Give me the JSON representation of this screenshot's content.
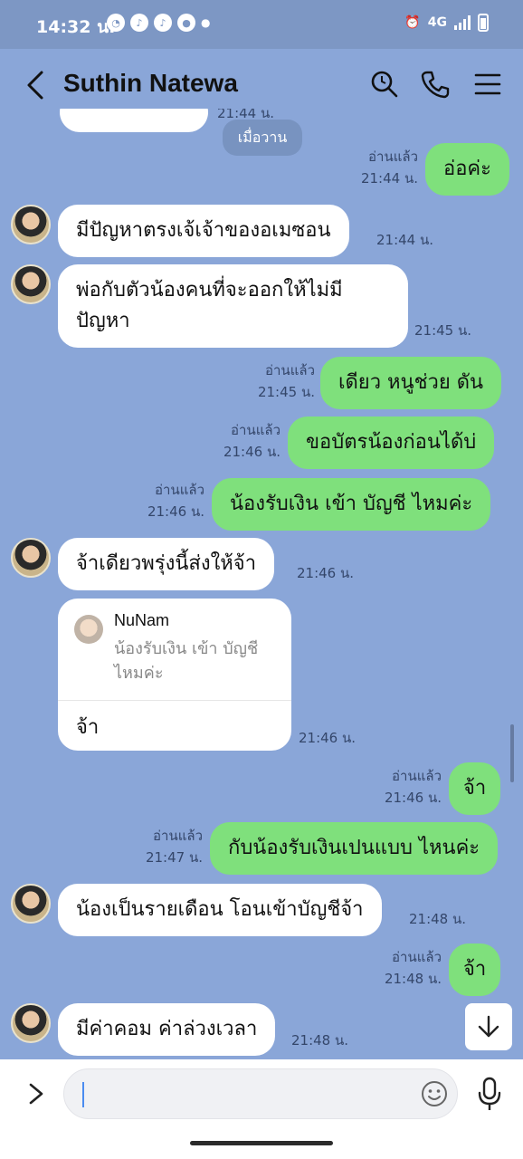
{
  "status_bar": {
    "time": "14:32 น.",
    "network": "4G"
  },
  "header": {
    "title": "Suthin Natewa"
  },
  "date_separator": "เมื่อวาน",
  "messages": [
    {
      "dir": "out",
      "text": "อ่อค่ะ",
      "read": "อ่านแล้ว",
      "time": "21:44 น."
    },
    {
      "dir": "in",
      "text": "มีปัญหาตรงเจ้เจ้าของอเมซอน",
      "time": "21:44 น."
    },
    {
      "dir": "in",
      "text": "พ่อกับตัวน้องคนที่จะออกให้ไม่มี\nปัญหา",
      "line1": "พ่อกับตัวน้องคนที่จะออกให้ไม่มี",
      "line2": "ปัญหา",
      "time": "21:45 น."
    },
    {
      "dir": "out",
      "text": "เดียว หนูช่วย ดัน",
      "read": "อ่านแล้ว",
      "time": "21:45 น."
    },
    {
      "dir": "out",
      "text": "ขอบัตรน้องก่อนได้บ่",
      "read": "อ่านแล้ว",
      "time": "21:46 น."
    },
    {
      "dir": "out",
      "text": "น้องรับเงิน เข้า บัญชี ไหมค่ะ",
      "read": "อ่านแล้ว",
      "time": "21:46 น."
    },
    {
      "dir": "in",
      "text": "จ้าเดียวพรุ่งนี้ส่งให้จ้า",
      "time": "21:46 น."
    },
    {
      "dir": "in",
      "reply_to_name": "NuNam",
      "reply_to_line1": "น้องรับเงิน เข้า บัญชี",
      "reply_to_line2": "ไหมค่ะ",
      "text": "จ้า",
      "time": "21:46 น."
    },
    {
      "dir": "out",
      "text": "จ้า",
      "read": "อ่านแล้ว",
      "time": "21:46 น."
    },
    {
      "dir": "out",
      "text": "กับน้องรับเงินเปนแบบ ไหนค่ะ",
      "read": "อ่านแล้ว",
      "time": "21:47 น."
    },
    {
      "dir": "in",
      "text": "น้องเป็นรายเดือน โอนเข้าบัญชีจ้า",
      "time": "21:48 น."
    },
    {
      "dir": "out",
      "text": "จ้า",
      "read": "อ่านแล้ว",
      "time": "21:48 น."
    },
    {
      "dir": "in",
      "text": "มีค่าคอม ค่าล่วงเวลา",
      "time": "21:48 น."
    }
  ],
  "partial_top_time": "21:44 น.",
  "input": {
    "value": "",
    "placeholder": ""
  },
  "colors": {
    "background": "#8aa6d8",
    "outgoing_bubble": "#7fe07c",
    "incoming_bubble": "#ffffff"
  },
  "icons": {
    "back": "chevron-left-icon",
    "search": "search-icon",
    "call": "phone-icon",
    "menu": "menu-icon",
    "expand": "chevron-right-icon",
    "emoji": "emoji-icon",
    "mic": "mic-icon",
    "scroll": "arrow-down-icon"
  }
}
